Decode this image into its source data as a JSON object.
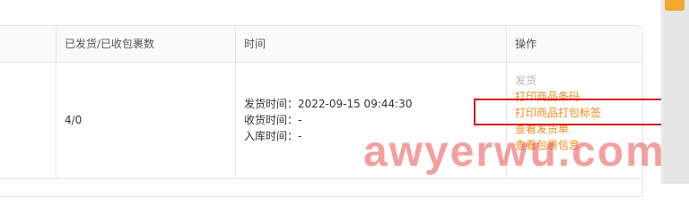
{
  "table": {
    "headers": {
      "shipped_received": "已发货/已收包裹数",
      "time": "时间",
      "actions": "操作"
    },
    "rows": [
      {
        "shipped_received": "4/0",
        "time": {
          "ship_time": "发货时间：2022-09-15 09:44:30",
          "receive_time": "收货时间：-",
          "storage_time": "入库时间：-"
        },
        "actions": {
          "ship": "发货",
          "print_barcode": "打印商品条码",
          "print_package_label": "打印商品打包标签",
          "view_invoice": "查看发货单",
          "view_package_info": "查看包裹信息"
        }
      }
    ]
  },
  "watermark": "awyerwu.com",
  "colors": {
    "link": "#f08a1c",
    "muted": "#b5b5b5",
    "highlight": "#d61818",
    "scroll_thumb": "#f3a72e"
  }
}
